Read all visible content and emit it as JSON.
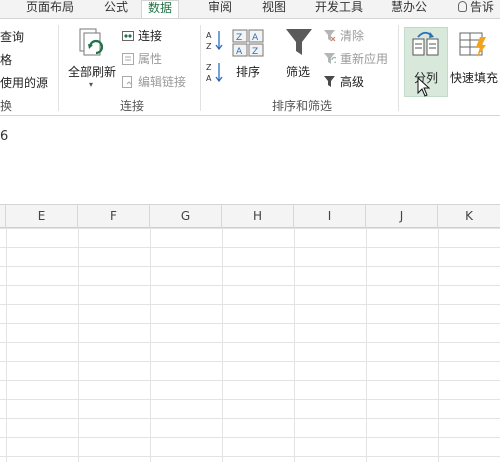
{
  "tabs": [
    {
      "label": "页面布局",
      "active": false
    },
    {
      "label": "公式",
      "active": false
    },
    {
      "label": "数据",
      "active": true
    },
    {
      "label": "审阅",
      "active": false
    },
    {
      "label": "视图",
      "active": false
    },
    {
      "label": "开发工具",
      "active": false
    },
    {
      "label": "慧办公",
      "active": false
    },
    {
      "label": "告诉",
      "active": false
    }
  ],
  "ribbon": {
    "left_partial": {
      "items": [
        "查询",
        "格",
        "使用的源"
      ],
      "group_label": "换"
    },
    "connections": {
      "refresh_all_label": "全部刷新",
      "connections_label": "连接",
      "properties_label": "属性",
      "edit_links_label": "编辑链接",
      "group_label": "连接"
    },
    "sort_filter": {
      "sort_label": "排序",
      "filter_label": "筛选",
      "clear_label": "清除",
      "reapply_label": "重新应用",
      "advanced_label": "高级",
      "group_label": "排序和筛选"
    },
    "data_tools": {
      "text_to_columns_label": "分列",
      "flash_fill_label": "快速填充"
    }
  },
  "formula_bar": {
    "value": "6"
  },
  "columns": [
    "E",
    "F",
    "G",
    "H",
    "I",
    "J",
    "K"
  ],
  "colors": {
    "accent": "#217346",
    "hover": "#d8e9dc",
    "funnel": "#5a5a5a",
    "flash": "#f2a31b"
  }
}
